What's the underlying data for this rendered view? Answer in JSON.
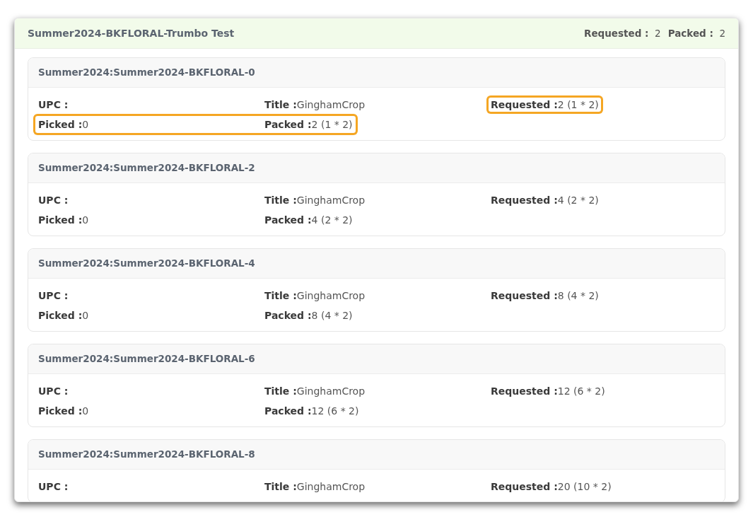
{
  "panel": {
    "title": "Summer2024-BKFLORAL-Trumbo Test",
    "totals": [
      {
        "label": "Requested :",
        "value": "2"
      },
      {
        "label": "Packed :",
        "value": "2"
      }
    ]
  },
  "cards": [
    {
      "title": "Summer2024:Summer2024-BKFLORAL-0",
      "rows": [
        {
          "highlighted": false,
          "fields": [
            {
              "label": "UPC :",
              "highlighted": false
            },
            {
              "label": "Title :",
              "value": "GinghamCrop",
              "highlighted": false
            },
            {
              "label": "Requested :",
              "value": "2 (1 * 2)",
              "highlighted": true
            }
          ]
        },
        {
          "highlighted": true,
          "fields": [
            {
              "label": "Picked :",
              "value": "0",
              "highlighted": false
            },
            {
              "label": "Packed :",
              "value": "2 (1 * 2)",
              "highlighted": false
            }
          ]
        }
      ]
    },
    {
      "title": "Summer2024:Summer2024-BKFLORAL-2",
      "rows": [
        {
          "highlighted": false,
          "fields": [
            {
              "label": "UPC :",
              "highlighted": false
            },
            {
              "label": "Title :",
              "value": "GinghamCrop",
              "highlighted": false
            },
            {
              "label": "Requested :",
              "value": "4 (2 * 2)",
              "highlighted": false
            }
          ]
        },
        {
          "highlighted": false,
          "fields": [
            {
              "label": "Picked :",
              "value": "0",
              "highlighted": false
            },
            {
              "label": "Packed :",
              "value": "4 (2 * 2)",
              "highlighted": false
            }
          ]
        }
      ]
    },
    {
      "title": "Summer2024:Summer2024-BKFLORAL-4",
      "rows": [
        {
          "highlighted": false,
          "fields": [
            {
              "label": "UPC :",
              "highlighted": false
            },
            {
              "label": "Title :",
              "value": "GinghamCrop",
              "highlighted": false
            },
            {
              "label": "Requested :",
              "value": "8 (4 * 2)",
              "highlighted": false
            }
          ]
        },
        {
          "highlighted": false,
          "fields": [
            {
              "label": "Picked :",
              "value": "0",
              "highlighted": false
            },
            {
              "label": "Packed :",
              "value": "8 (4 * 2)",
              "highlighted": false
            }
          ]
        }
      ]
    },
    {
      "title": "Summer2024:Summer2024-BKFLORAL-6",
      "rows": [
        {
          "highlighted": false,
          "fields": [
            {
              "label": "UPC :",
              "highlighted": false
            },
            {
              "label": "Title :",
              "value": "GinghamCrop",
              "highlighted": false
            },
            {
              "label": "Requested :",
              "value": "12 (6 * 2)",
              "highlighted": false
            }
          ]
        },
        {
          "highlighted": false,
          "fields": [
            {
              "label": "Picked :",
              "value": "0",
              "highlighted": false
            },
            {
              "label": "Packed :",
              "value": "12 (6 * 2)",
              "highlighted": false
            }
          ]
        }
      ]
    },
    {
      "title": "Summer2024:Summer2024-BKFLORAL-8",
      "rows": [
        {
          "highlighted": false,
          "fields": [
            {
              "label": "UPC :",
              "highlighted": false
            },
            {
              "label": "Title :",
              "value": "GinghamCrop",
              "highlighted": false
            },
            {
              "label": "Requested :",
              "value": "20 (10 * 2)",
              "highlighted": false
            }
          ]
        }
      ]
    }
  ]
}
